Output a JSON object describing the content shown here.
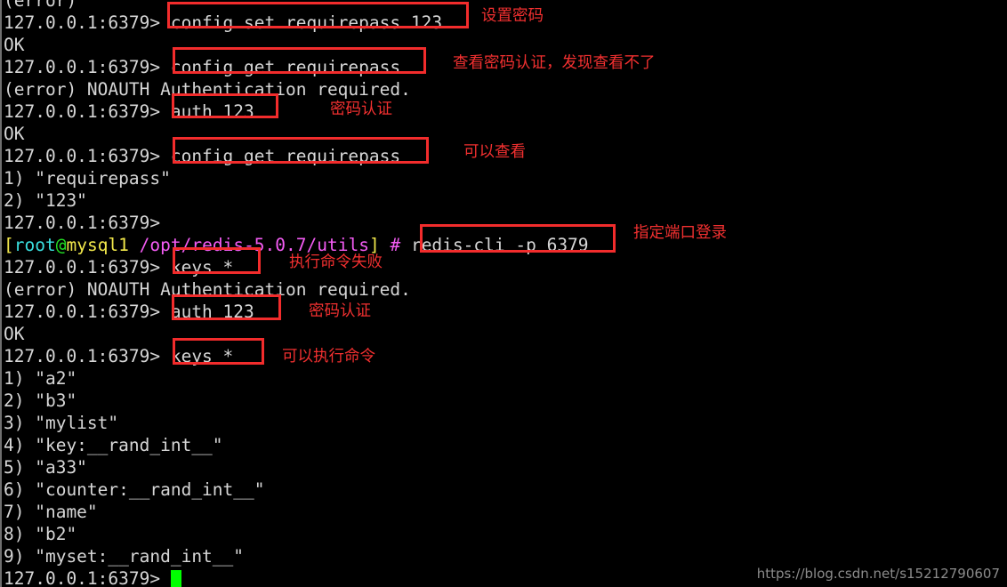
{
  "terminal": {
    "prompt_redis": "127.0.0.1:6379>",
    "lines": [
      {
        "id": "line-0-partial",
        "text": "(error)"
      },
      {
        "id": "line-1-prompt",
        "text": "127.0.0.1:6379> config set requirepass 123"
      },
      {
        "id": "line-2-ok",
        "text": "OK"
      },
      {
        "id": "line-3-prompt",
        "text": "127.0.0.1:6379> config get requirepass"
      },
      {
        "id": "line-4-error",
        "text": "(error) NOAUTH Authentication required."
      },
      {
        "id": "line-5-prompt",
        "text": "127.0.0.1:6379> auth 123"
      },
      {
        "id": "line-6-ok",
        "text": "OK"
      },
      {
        "id": "line-7-prompt",
        "text": "127.0.0.1:6379> config get requirepass"
      },
      {
        "id": "line-8-result",
        "text": "1) \"requirepass\""
      },
      {
        "id": "line-9-result",
        "text": "2) \"123\""
      },
      {
        "id": "line-10-prompt",
        "text": "127.0.0.1:6379>"
      },
      {
        "id": "line-12-prompt",
        "text": "127.0.0.1:6379> keys *"
      },
      {
        "id": "line-13-error",
        "text": "(error) NOAUTH Authentication required."
      },
      {
        "id": "line-14-prompt",
        "text": "127.0.0.1:6379> auth 123"
      },
      {
        "id": "line-15-ok",
        "text": "OK"
      },
      {
        "id": "line-16-prompt",
        "text": "127.0.0.1:6379> keys *"
      },
      {
        "id": "line-17-key",
        "text": "1) \"a2\""
      },
      {
        "id": "line-18-key",
        "text": "2) \"b3\""
      },
      {
        "id": "line-19-key",
        "text": "3) \"mylist\""
      },
      {
        "id": "line-20-key",
        "text": "4) \"key:__rand_int__\""
      },
      {
        "id": "line-21-key",
        "text": "5) \"a33\""
      },
      {
        "id": "line-22-key",
        "text": "6) \"counter:__rand_int__\""
      },
      {
        "id": "line-23-key",
        "text": "7) \"name\""
      },
      {
        "id": "line-24-key",
        "text": "8) \"b2\""
      },
      {
        "id": "line-25-key",
        "text": "9) \"myset:__rand_int__\""
      }
    ],
    "shell_prompt": {
      "bracket_open": "[",
      "user": "root",
      "at": "@",
      "host": "mysql1",
      "space": " ",
      "path": "/opt/redis-5.0.7/utils",
      "bracket_close": "]",
      "symbol": "#",
      "command": "redis-cli -p 6379"
    },
    "last_prompt": "127.0.0.1:6379>"
  },
  "annotations": [
    {
      "id": "note-set-password",
      "text": "设置密码"
    },
    {
      "id": "note-view-auth-fail",
      "text": "查看密码认证，发现查看不了"
    },
    {
      "id": "note-auth-1",
      "text": "密码认证"
    },
    {
      "id": "note-can-view",
      "text": "可以查看"
    },
    {
      "id": "note-login-port",
      "text": "指定端口登录"
    },
    {
      "id": "note-cmd-failed",
      "text": "执行命令失败"
    },
    {
      "id": "note-auth-2",
      "text": "密码认证"
    },
    {
      "id": "note-can-run",
      "text": "可以执行命令"
    }
  ],
  "watermark": {
    "url": "https://blog.csdn.net/s15212790607"
  },
  "colors": {
    "background": "#000000",
    "text": "#d6d6d6",
    "highlight_box": "#f22c2c",
    "annotation": "#f23030",
    "cursor": "#00ff00",
    "prompt_user": "#3ae0e0",
    "prompt_host": "#f2e84b",
    "prompt_path": "#f45cf4"
  }
}
